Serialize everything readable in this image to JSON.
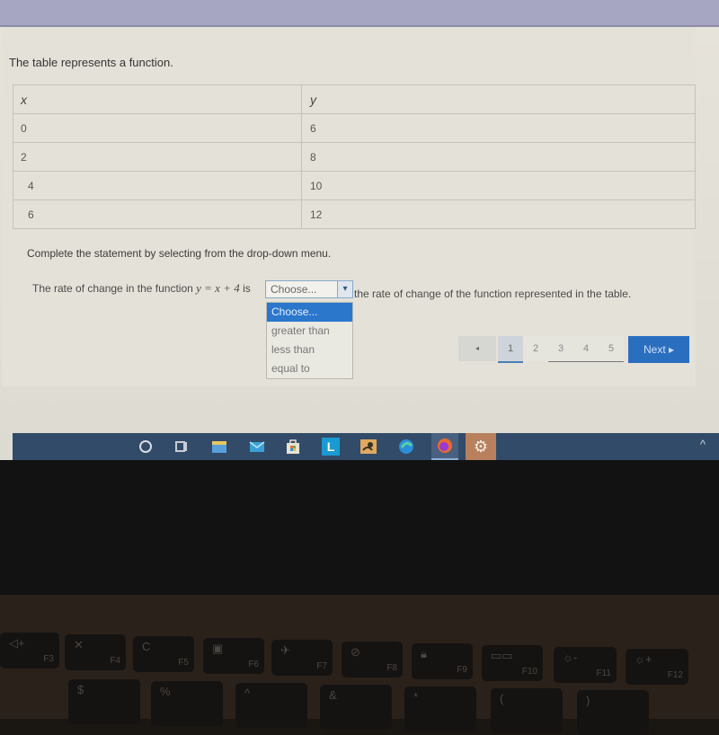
{
  "question": {
    "intro": "The table represents a function.",
    "table": {
      "headers": [
        "x",
        "y"
      ],
      "rows": [
        [
          "0",
          "6"
        ],
        [
          "2",
          "8"
        ],
        [
          "4",
          "10"
        ],
        [
          "6",
          "12"
        ]
      ]
    },
    "instruction": "Complete the statement by selecting from the drop-down menu.",
    "statement_before": "The rate of change in the function",
    "equation": "y = x + 4",
    "statement_is": "is",
    "statement_after": "the rate of change of the function represented in the table.",
    "dropdown": {
      "selected": "Choose...",
      "arrow": "▾",
      "options": [
        "Choose...",
        "greater than",
        "less than",
        "equal to"
      ],
      "highlighted_index": 0
    }
  },
  "pagination": {
    "prev": "◂",
    "pages": [
      "1",
      "2",
      "3",
      "4",
      "5"
    ],
    "current": "1",
    "next_label": "Next ▸"
  },
  "taskbar": {
    "icons": [
      "search-circle",
      "task-view",
      "file-explorer",
      "mail",
      "store",
      "app-l",
      "app-photo",
      "edge",
      "firefox",
      "settings"
    ],
    "app_l_letter": "L",
    "tray_chevron": "^"
  },
  "keyboard": {
    "fn_keys": [
      {
        "glyph": "◁+",
        "label": "F3"
      },
      {
        "glyph": "✕",
        "label": "F4"
      },
      {
        "glyph": "C",
        "label": "F5"
      },
      {
        "glyph": "▣",
        "label": "F6"
      },
      {
        "glyph": "✈",
        "label": "F7"
      },
      {
        "glyph": "⊘",
        "label": "F8"
      },
      {
        "glyph": "🔒︎",
        "label": "F9"
      },
      {
        "glyph": "▭▭",
        "label": "F10"
      },
      {
        "glyph": "☼-",
        "label": "F11"
      },
      {
        "glyph": "☼+",
        "label": "F12"
      }
    ],
    "num_keys": [
      "$",
      "%",
      "^",
      "&",
      "*",
      "(",
      ")"
    ]
  }
}
